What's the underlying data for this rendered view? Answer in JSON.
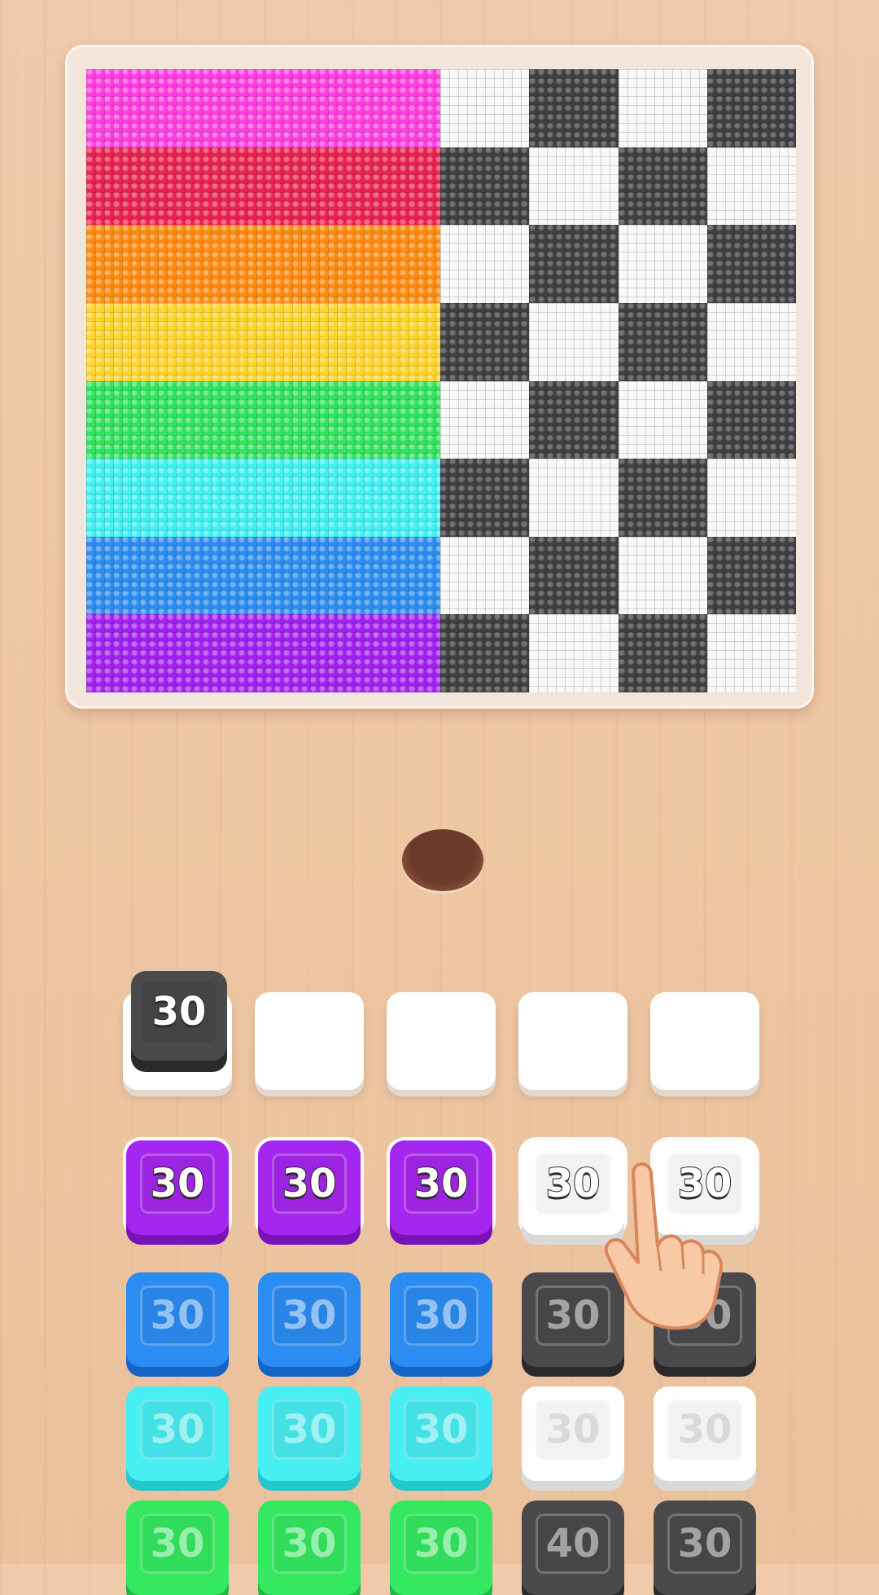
{
  "palette": {
    "rainbow": [
      "#ff3ce0",
      "#e8214f",
      "#ff8a10",
      "#ffd42a",
      "#2fe35c",
      "#3ff0f2",
      "#2a8cf0",
      "#a11ff0"
    ],
    "checker_dark": "#3f3f41",
    "checker_light": "#f7f7f7"
  },
  "checker_pattern_dark_first_col": [
    false,
    true,
    false,
    true,
    false,
    true,
    false,
    true
  ],
  "queue": [
    {
      "value": "30",
      "color": "dark"
    },
    {
      "value": "",
      "color": "empty"
    },
    {
      "value": "",
      "color": "empty"
    },
    {
      "value": "",
      "color": "empty"
    },
    {
      "value": "",
      "color": "empty"
    }
  ],
  "grid": [
    [
      {
        "value": "30",
        "color": "purple",
        "state": "active"
      },
      {
        "value": "30",
        "color": "purple",
        "state": "active"
      },
      {
        "value": "30",
        "color": "purple",
        "state": "active"
      },
      {
        "value": "30",
        "color": "white",
        "state": "active"
      },
      {
        "value": "30",
        "color": "white",
        "state": "active"
      }
    ],
    [
      {
        "value": "30",
        "color": "blue",
        "state": "faded"
      },
      {
        "value": "30",
        "color": "blue",
        "state": "faded"
      },
      {
        "value": "30",
        "color": "blue",
        "state": "faded"
      },
      {
        "value": "30",
        "color": "dark",
        "state": "faded"
      },
      {
        "value": "30",
        "color": "dark",
        "state": "faded"
      }
    ],
    [
      {
        "value": "30",
        "color": "cyan",
        "state": "faded"
      },
      {
        "value": "30",
        "color": "cyan",
        "state": "faded"
      },
      {
        "value": "30",
        "color": "cyan",
        "state": "faded"
      },
      {
        "value": "30",
        "color": "white",
        "state": "faded"
      },
      {
        "value": "30",
        "color": "white",
        "state": "faded"
      }
    ],
    [
      {
        "value": "30",
        "color": "green",
        "state": "faded"
      },
      {
        "value": "30",
        "color": "green",
        "state": "faded"
      },
      {
        "value": "30",
        "color": "green",
        "state": "faded"
      },
      {
        "value": "40",
        "color": "dark",
        "state": "faded"
      },
      {
        "value": "30",
        "color": "dark",
        "state": "faded"
      }
    ]
  ],
  "tile_colors": {
    "purple": [
      "#a526ee",
      "#7a12b8"
    ],
    "blue": [
      "#2b8cf2",
      "#1565c8"
    ],
    "cyan": [
      "#47eef2",
      "#25c6cc"
    ],
    "green": [
      "#34e85f",
      "#1fb945"
    ],
    "white": [
      "#ffffff",
      "#d9d9d9"
    ],
    "dark": [
      "#4a4a4c",
      "#2a2a2c"
    ]
  },
  "hand_icon": "pointing-hand-icon"
}
